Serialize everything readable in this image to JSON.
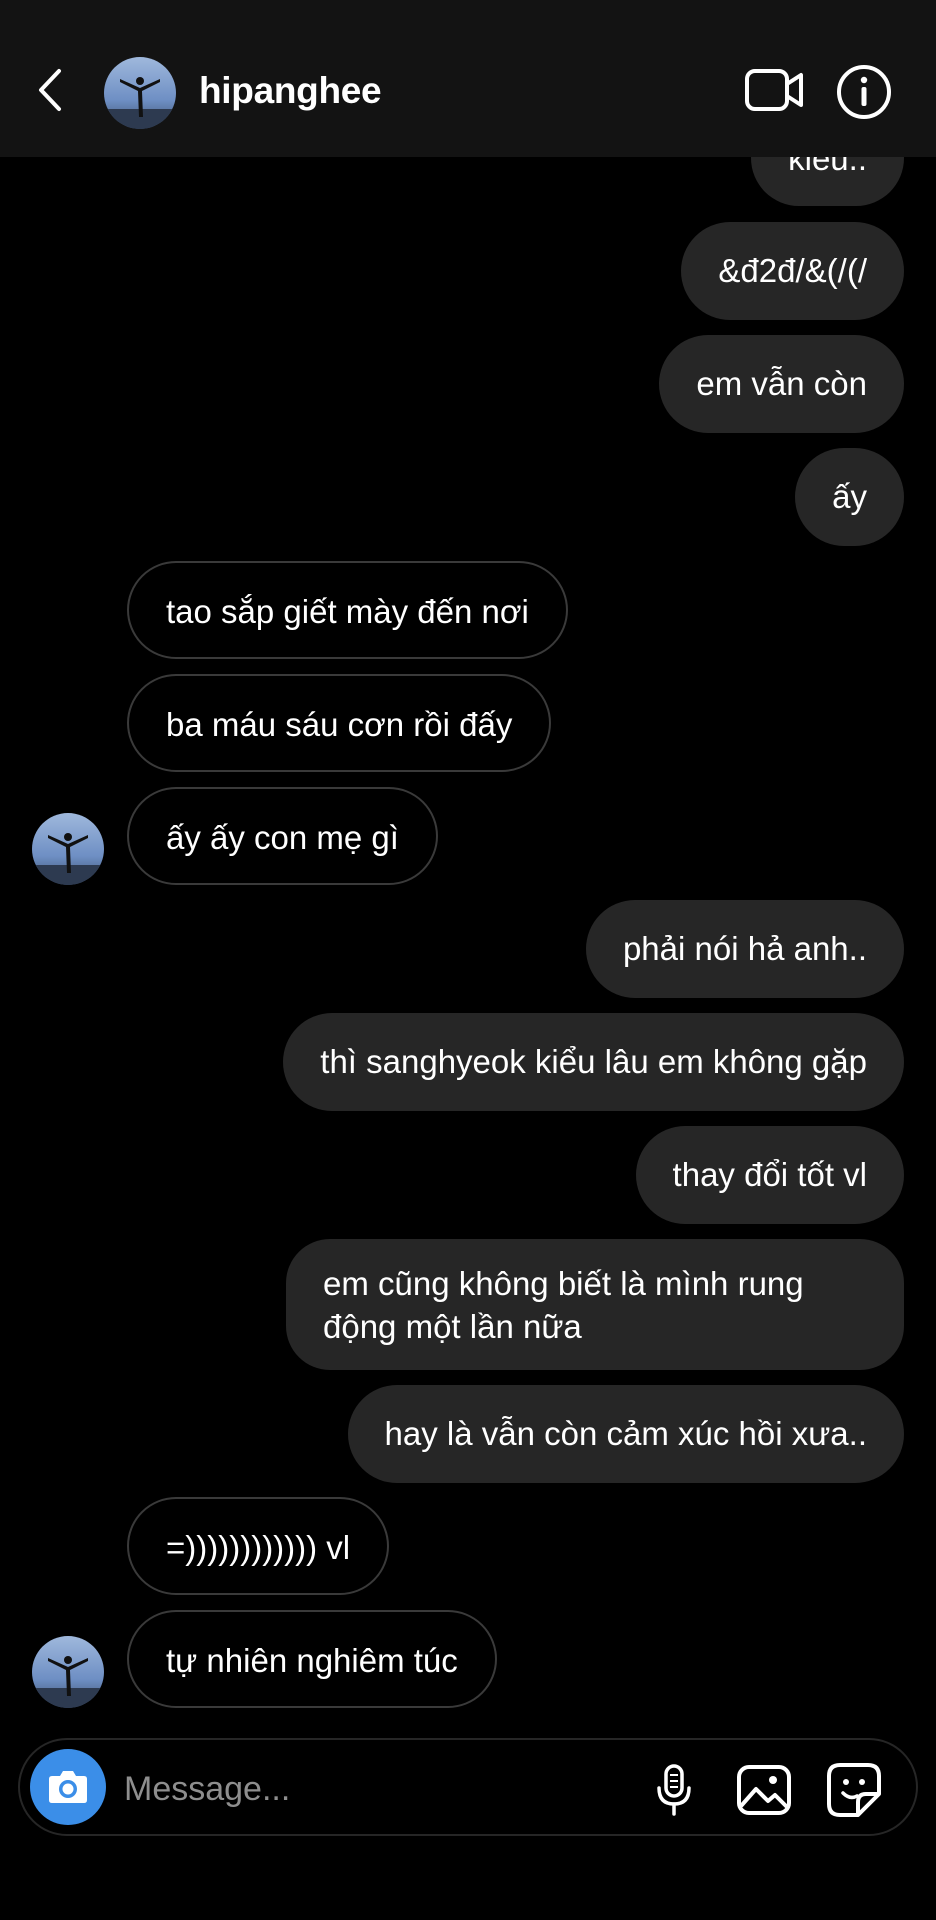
{
  "header": {
    "username": "hipanghee",
    "back_icon": "chevron-left-icon",
    "video_icon": "video-call-icon",
    "info_icon": "info-icon"
  },
  "messages": [
    {
      "side": "out",
      "text": "kiểu.."
    },
    {
      "side": "out",
      "text": "&đ2đ/&(/(/"
    },
    {
      "side": "out",
      "text": "em vẫn còn"
    },
    {
      "side": "out",
      "text": "ấy"
    },
    {
      "side": "in",
      "text": "tao sắp giết mày đến nơi"
    },
    {
      "side": "in",
      "text": "ba máu sáu cơn rồi đấy"
    },
    {
      "side": "in",
      "text": "ấy ấy con mẹ gì"
    },
    {
      "side": "out",
      "text": "phải nói hả anh.."
    },
    {
      "side": "out",
      "text": "thì sanghyeok kiểu lâu em không gặp"
    },
    {
      "side": "out",
      "text": "thay đổi tốt vl"
    },
    {
      "side": "out",
      "text": "em cũng không biết là mình rung động một lần nữa"
    },
    {
      "side": "out",
      "text": "hay là vẫn còn cảm xúc hồi xưa.."
    },
    {
      "side": "in",
      "text": "=)))))))))))) vl"
    },
    {
      "side": "in",
      "text": "tự nhiên nghiêm túc"
    }
  ],
  "composer": {
    "placeholder": "Message...",
    "camera_icon": "camera-icon",
    "mic_icon": "microphone-icon",
    "gallery_icon": "image-gallery-icon",
    "sticker_icon": "sticker-icon",
    "accent": "#3b8ee8"
  },
  "colors": {
    "background": "#000000",
    "header": "#131313",
    "outgoing_bubble": "#262626",
    "incoming_border": "#3a3a3a"
  }
}
